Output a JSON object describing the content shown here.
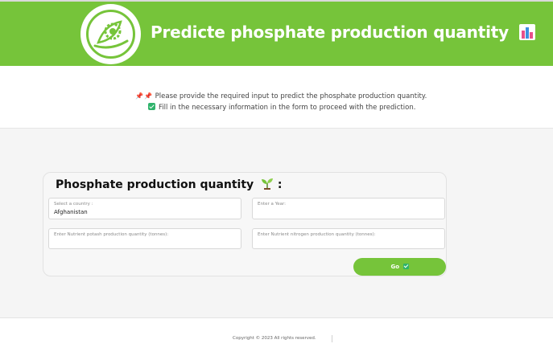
{
  "header": {
    "title": "Predicte phosphate production quantity",
    "title_icon": "bar-chart-icon",
    "logo_icon": "eco-gear-leaf-logo",
    "background_color": "#76c43a"
  },
  "intro": {
    "line1_icon": "pushpin-icon",
    "line1_text": "Please provide the required input to predict the phosphate production quantity.",
    "line2_icon": "check-mark-icon",
    "line2_text": "Fill in the necessary information in the form to proceed with the prediction."
  },
  "form": {
    "title": "Phosphate production quantity",
    "title_suffix": ":",
    "title_icon": "seedling-icon",
    "fields": [
      {
        "label": "Select a country :",
        "value": "Afghanistan"
      },
      {
        "label": "Enter a Year:",
        "value": ""
      },
      {
        "label": "Enter Nutrient potash production quantity (tonnes):",
        "value": ""
      },
      {
        "label": "Enter Nutrient nitrogen production quantity (tonnes):",
        "value": ""
      }
    ],
    "submit_label": "Go",
    "submit_icon": "check-mark-icon",
    "accent_color": "#76c43a"
  },
  "footer": {
    "copyright": "Copyright © 2023 All rights reserved."
  }
}
